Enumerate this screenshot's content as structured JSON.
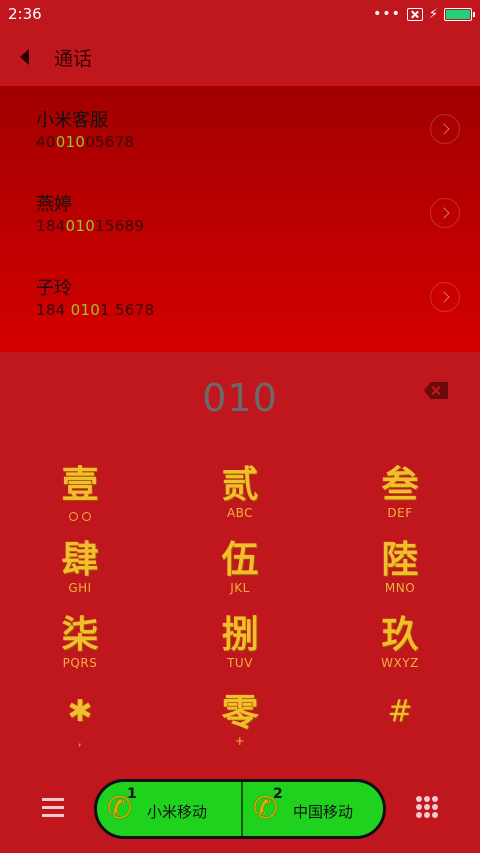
{
  "status_bar": {
    "time": "2:36",
    "dots": "•••"
  },
  "header": {
    "title": "通话"
  },
  "results": [
    {
      "name": "小米客服",
      "number_pre": "40",
      "number_match": "010",
      "number_post": "05678"
    },
    {
      "name": "燕婷",
      "number_pre": "184",
      "number_match": "010",
      "number_post": "15689"
    },
    {
      "name": "子玲",
      "number_pre": "184 ",
      "number_match": "010",
      "number_post": "1 5678"
    }
  ],
  "dial_input": "010",
  "keys": [
    {
      "glyph": "壹",
      "sub": ""
    },
    {
      "glyph": "贰",
      "sub": "ABC"
    },
    {
      "glyph": "叁",
      "sub": "DEF"
    },
    {
      "glyph": "肆",
      "sub": "GHI"
    },
    {
      "glyph": "伍",
      "sub": "JKL"
    },
    {
      "glyph": "陸",
      "sub": "MNO"
    },
    {
      "glyph": "柒",
      "sub": "PQRS"
    },
    {
      "glyph": "捌",
      "sub": "TUV"
    },
    {
      "glyph": "玖",
      "sub": "WXYZ"
    },
    {
      "glyph": "✱",
      "sub": ","
    },
    {
      "glyph": "零",
      "sub": "+"
    },
    {
      "glyph": "#",
      "sub": ""
    }
  ],
  "bottom": {
    "sim1": {
      "index": "1",
      "label": "小米移动"
    },
    "sim2": {
      "index": "2",
      "label": "中国移动"
    }
  },
  "colors": {
    "background": "#c0161e",
    "gold": "#f3bd2c",
    "call_green": "#1ed21e",
    "match_highlight": "#99c23a"
  }
}
